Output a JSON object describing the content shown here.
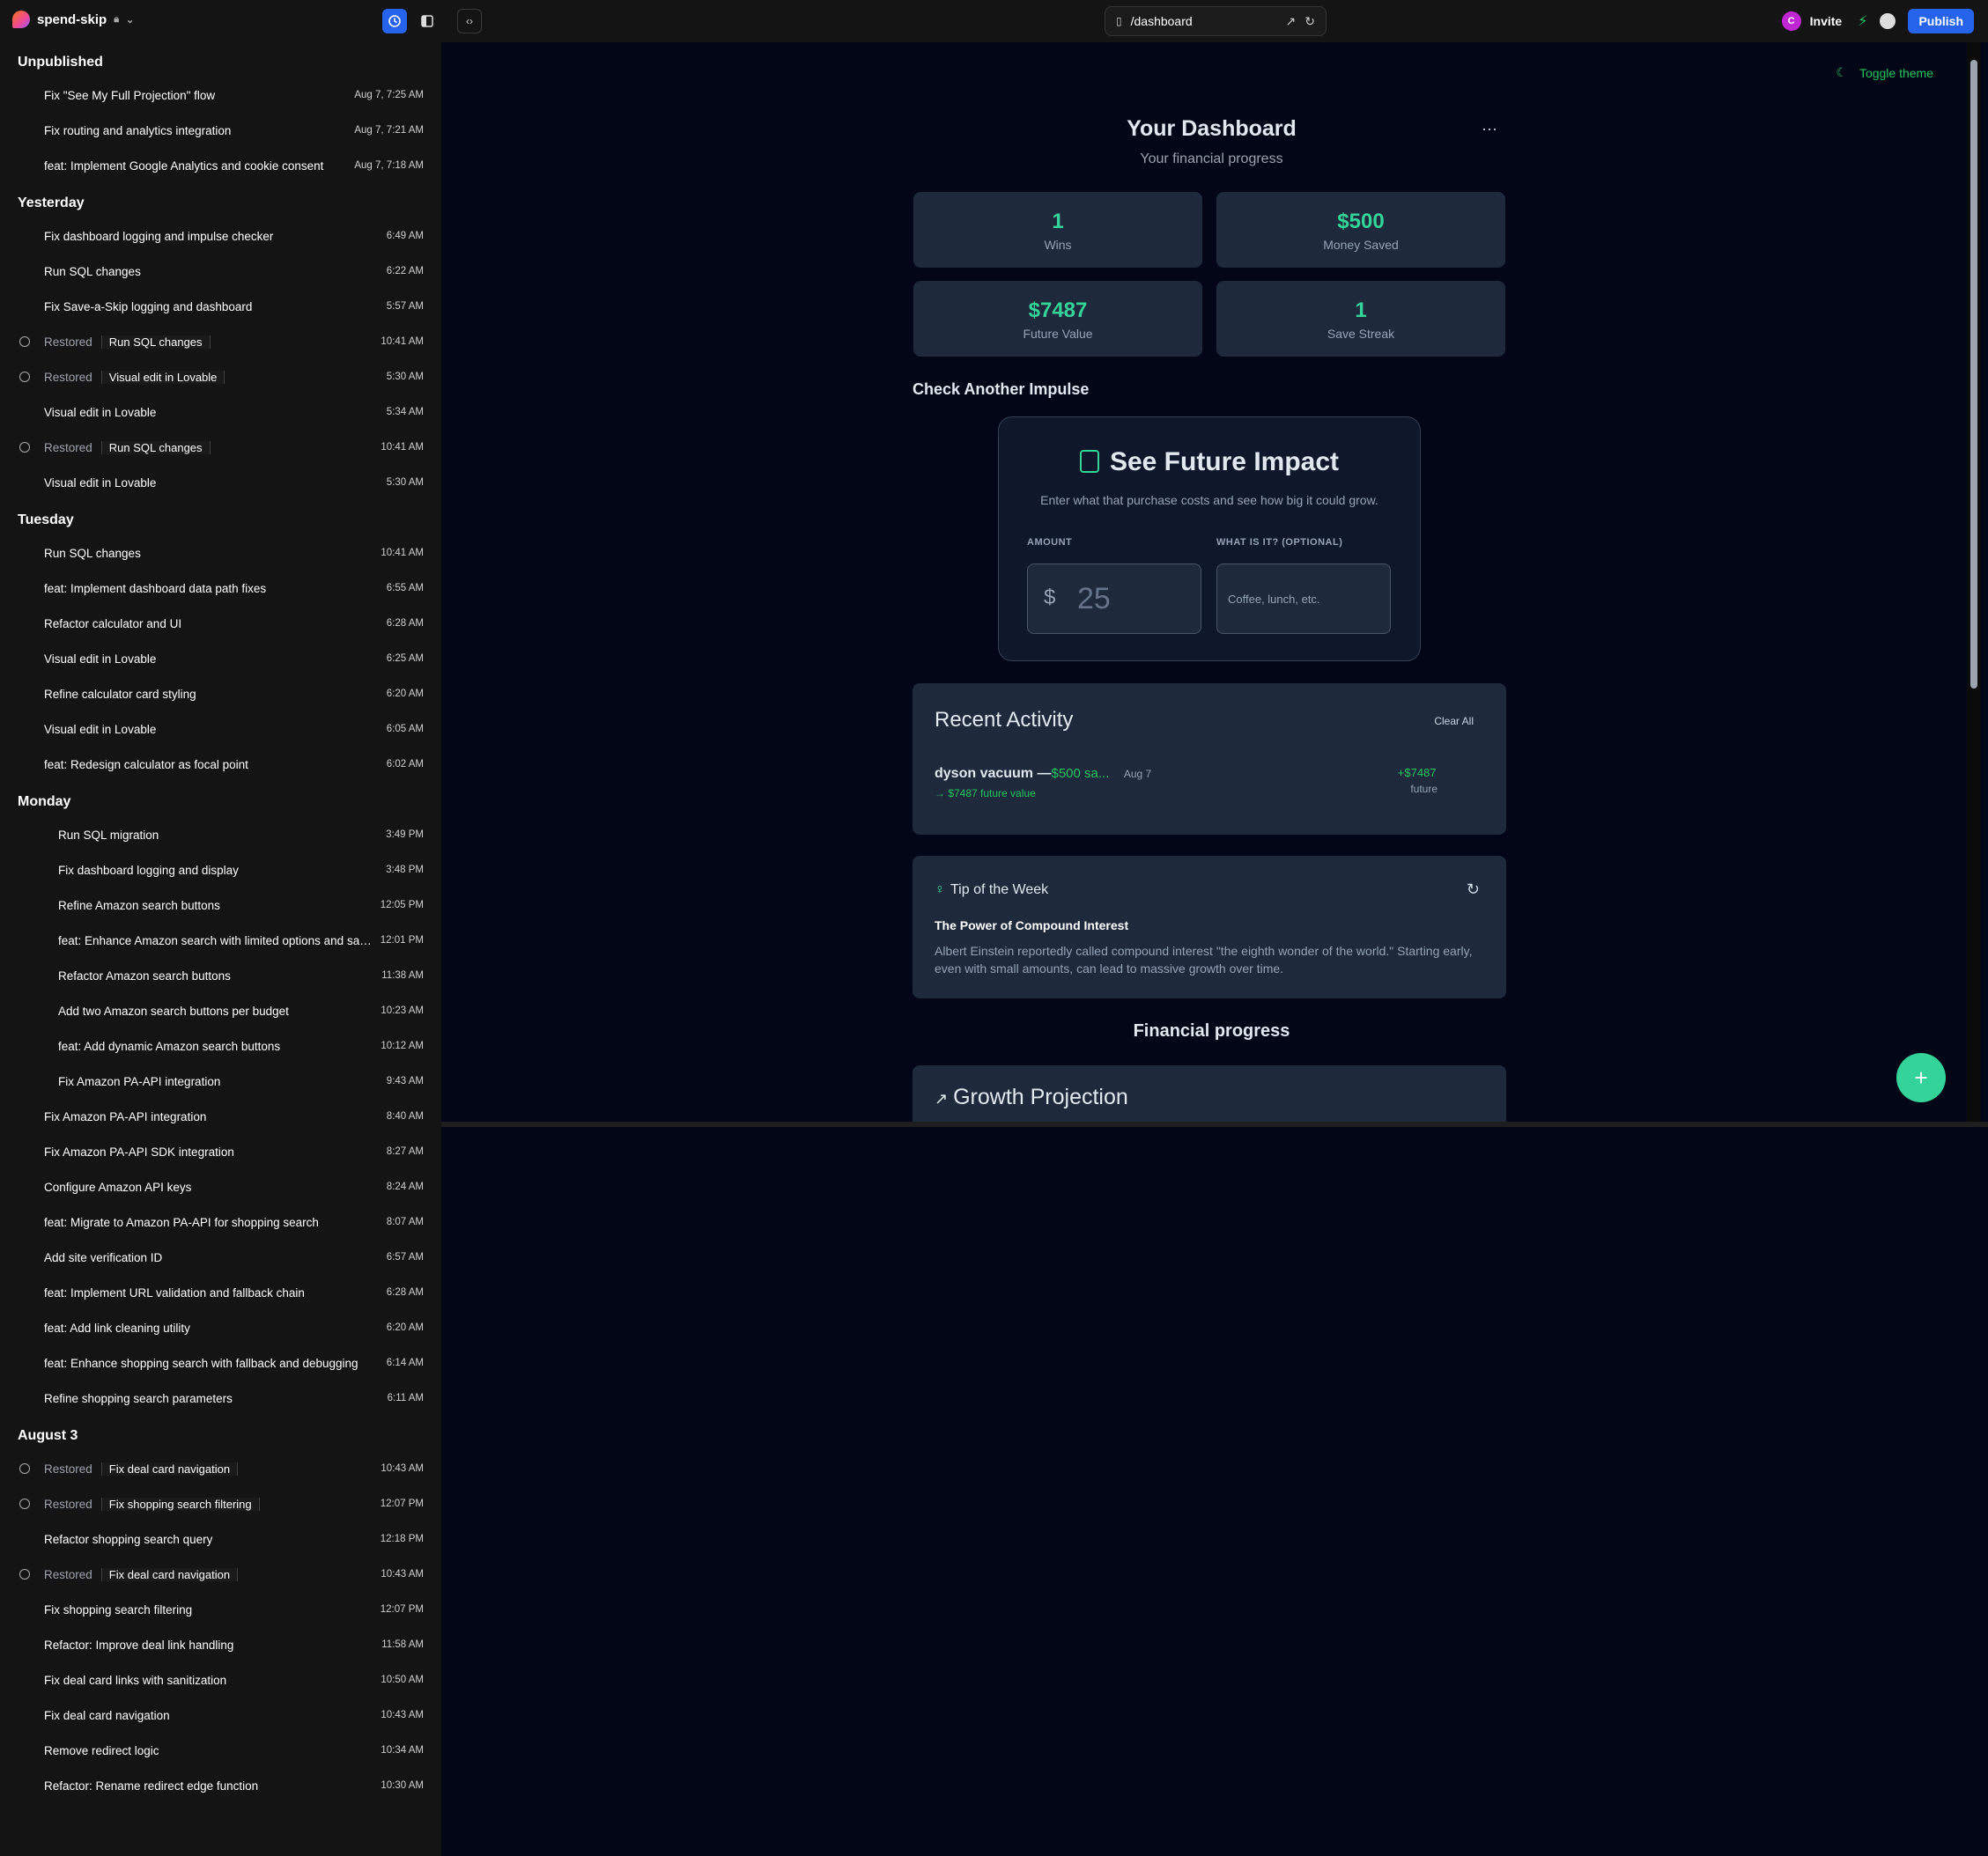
{
  "topbar": {
    "project": "spend-skip",
    "url": "/dashboard",
    "avatar": "C",
    "invite": "Invite",
    "publish": "Publish"
  },
  "history": [
    {
      "group": "Unpublished",
      "items": [
        {
          "label": "Fix \"See My Full Projection\" flow",
          "time": "Aug 7, 7:25 AM"
        },
        {
          "label": "Fix routing and analytics integration",
          "time": "Aug 7, 7:21 AM"
        },
        {
          "label": "feat: Implement Google Analytics and cookie consent",
          "time": "Aug 7, 7:18 AM"
        }
      ]
    },
    {
      "group": "Yesterday",
      "items": [
        {
          "label": "Fix dashboard logging and impulse checker",
          "time": "6:49 AM"
        },
        {
          "label": "Run SQL changes",
          "time": "6:22 AM"
        },
        {
          "label": "Fix Save-a-Skip logging and dashboard",
          "time": "5:57 AM"
        },
        {
          "restored": "Restored",
          "label": "Run SQL changes",
          "time": "10:41 AM"
        },
        {
          "restored": "Restored",
          "label": "Visual edit in Lovable",
          "time": "5:30 AM"
        },
        {
          "label": "Visual edit in Lovable",
          "time": "5:34 AM"
        },
        {
          "restored": "Restored",
          "label": "Run SQL changes",
          "time": "10:41 AM"
        },
        {
          "label": "Visual edit in Lovable",
          "time": "5:30 AM"
        }
      ]
    },
    {
      "group": "Tuesday",
      "items": [
        {
          "label": "Run SQL changes",
          "time": "10:41 AM"
        },
        {
          "label": "feat: Implement dashboard data path fixes",
          "time": "6:55 AM"
        },
        {
          "label": "Refactor calculator and UI",
          "time": "6:28 AM"
        },
        {
          "label": "Visual edit in Lovable",
          "time": "6:25 AM"
        },
        {
          "label": "Refine calculator card styling",
          "time": "6:20 AM"
        },
        {
          "label": "Visual edit in Lovable",
          "time": "6:05 AM"
        },
        {
          "label": "feat: Redesign calculator as focal point",
          "time": "6:02 AM"
        }
      ]
    },
    {
      "group": "Monday",
      "indent": true,
      "items": [
        {
          "label": "Run SQL migration",
          "time": "3:49 PM"
        },
        {
          "label": "Fix dashboard logging and display",
          "time": "3:48 PM"
        },
        {
          "label": "Refine Amazon search buttons",
          "time": "12:05 PM"
        },
        {
          "label": "feat: Enhance Amazon search with limited options and savings",
          "time": "12:01 PM"
        },
        {
          "label": "Refactor Amazon search buttons",
          "time": "11:38 AM"
        },
        {
          "label": "Add two Amazon search buttons per budget",
          "time": "10:23 AM"
        },
        {
          "label": "feat: Add dynamic Amazon search buttons",
          "time": "10:12 AM"
        },
        {
          "label": "Fix Amazon PA-API integration",
          "time": "9:43 AM"
        }
      ]
    },
    {
      "group": "",
      "items": [
        {
          "label": "Fix Amazon PA-API integration",
          "time": "8:40 AM"
        },
        {
          "label": "Fix Amazon PA-API SDK integration",
          "time": "8:27 AM"
        },
        {
          "label": "Configure Amazon API keys",
          "time": "8:24 AM"
        },
        {
          "label": "feat: Migrate to Amazon PA-API for shopping search",
          "time": "8:07 AM"
        },
        {
          "label": "Add site verification ID",
          "time": "6:57 AM"
        },
        {
          "label": "feat: Implement URL validation and fallback chain",
          "time": "6:28 AM"
        },
        {
          "label": "feat: Add link cleaning utility",
          "time": "6:20 AM"
        },
        {
          "label": "feat: Enhance shopping search with fallback and debugging",
          "time": "6:14 AM"
        },
        {
          "label": "Refine shopping search parameters",
          "time": "6:11 AM"
        }
      ]
    },
    {
      "group": "August 3",
      "items": [
        {
          "restored": "Restored",
          "label": "Fix deal card navigation",
          "time": "10:43 AM"
        },
        {
          "restored": "Restored",
          "label": "Fix shopping search filtering",
          "time": "12:07 PM"
        },
        {
          "label": "Refactor shopping search query",
          "time": "12:18 PM"
        },
        {
          "restored": "Restored",
          "label": "Fix deal card navigation",
          "time": "10:43 AM"
        },
        {
          "label": "Fix shopping search filtering",
          "time": "12:07 PM"
        },
        {
          "label": "Refactor: Improve deal link handling",
          "time": "11:58 AM"
        },
        {
          "label": "Fix deal card links with sanitization",
          "time": "10:50 AM"
        },
        {
          "label": "Fix deal card navigation",
          "time": "10:43 AM"
        },
        {
          "label": "Remove redirect logic",
          "time": "10:34 AM"
        },
        {
          "label": "Refactor: Rename redirect edge function",
          "time": "10:30 AM"
        }
      ]
    }
  ],
  "preview": {
    "toggle": "Toggle theme",
    "title": "Your Dashboard",
    "subtitle": "Your financial progress",
    "stats": [
      {
        "value": "1",
        "label": "Wins"
      },
      {
        "value": "$500",
        "label": "Money Saved"
      },
      {
        "value": "$7487",
        "label": "Future Value"
      },
      {
        "value": "1",
        "label": "Save Streak"
      }
    ],
    "check_title": "Check Another Impulse",
    "calc": {
      "title": "See Future Impact",
      "subtitle": "Enter what that purchase costs and see how big it could grow.",
      "amount_label": "AMOUNT",
      "what_label": "WHAT IS IT? (OPTIONAL)",
      "currency": "$",
      "amount_placeholder": "25",
      "what_placeholder": "Coffee, lunch, etc."
    },
    "recent": {
      "title": "Recent Activity",
      "clear": "Clear All",
      "item_name": "dyson vacuum —",
      "item_saved": "$500 sa...",
      "item_date": "Aug 7",
      "item_future": "→ $7487 future value",
      "right_value": "+$7487",
      "right_label": "future"
    },
    "tip": {
      "title": "Tip of the Week",
      "heading": "The Power of Compound Interest",
      "body": "Albert Einstein reportedly called compound interest \"the eighth wonder of the world.\" Starting early, even with small amounts, can lead to massive growth over time."
    },
    "progress_title": "Financial progress",
    "growth_title": "Growth Projection"
  }
}
